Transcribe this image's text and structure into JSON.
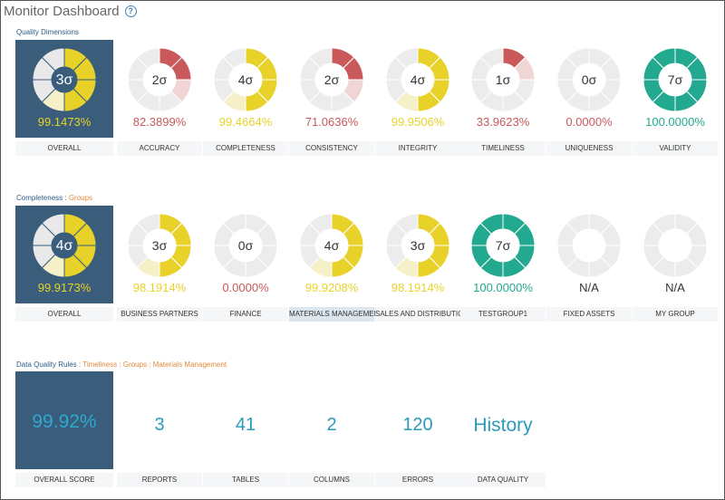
{
  "title": "Monitor Dashboard",
  "help_icon": "?",
  "colors": {
    "red": "#c9595b",
    "yellow": "#e8d22a",
    "green": "#22a98f",
    "blue": "#2a9abb",
    "tile": "#3a5d7c",
    "track": "#ececec"
  },
  "quality": {
    "label": "Quality Dimensions",
    "cards": [
      {
        "caption": "OVERALL",
        "sigma": "3σ",
        "pct": "99.1473%",
        "value": 0.6,
        "color": "yellow",
        "overall": true
      },
      {
        "caption": "ACCURACY",
        "sigma": "2σ",
        "pct": "82.3899%",
        "value": 0.35,
        "color": "red"
      },
      {
        "caption": "COMPLETENESS",
        "sigma": "4σ",
        "pct": "99.4664%",
        "value": 0.6,
        "color": "yellow"
      },
      {
        "caption": "CONSISTENCY",
        "sigma": "2σ",
        "pct": "71.0636%",
        "value": 0.25,
        "color": "red"
      },
      {
        "caption": "INTEGRITY",
        "sigma": "4σ",
        "pct": "99.9506%",
        "value": 0.62,
        "color": "yellow"
      },
      {
        "caption": "TIMELINESS",
        "sigma": "1σ",
        "pct": "33.9623%",
        "value": 0.13,
        "color": "red"
      },
      {
        "caption": "UNIQUENESS",
        "sigma": "0σ",
        "pct": "0.0000%",
        "value": 0,
        "color": "red"
      },
      {
        "caption": "VALIDITY",
        "sigma": "7σ",
        "pct": "100.0000%",
        "value": 1,
        "color": "green"
      }
    ]
  },
  "completeness": {
    "label": "Completeness",
    "sep": " : ",
    "link": "Groups",
    "cards": [
      {
        "caption": "OVERALL",
        "sigma": "4σ",
        "pct": "99.9173%",
        "value": 0.62,
        "color": "yellow",
        "overall": true
      },
      {
        "caption": "BUSINESS PARTNERS",
        "sigma": "3σ",
        "pct": "98.1914%",
        "value": 0.6,
        "color": "yellow"
      },
      {
        "caption": "FINANCE",
        "sigma": "0σ",
        "pct": "0.0000%",
        "value": 0,
        "color": "red"
      },
      {
        "caption": "MATERIALS MANAGEMENT",
        "sigma": "4σ",
        "pct": "99.9208%",
        "value": 0.62,
        "color": "yellow",
        "selected": true
      },
      {
        "caption": "SALES AND DISTRIBUTION",
        "sigma": "3σ",
        "pct": "98.1914%",
        "value": 0.6,
        "color": "yellow"
      },
      {
        "caption": "TESTGROUP1",
        "sigma": "7σ",
        "pct": "100.0000%",
        "value": 1,
        "color": "green"
      },
      {
        "caption": "FIXED ASSETS",
        "sigma": "",
        "pct": "N/A",
        "value": 0,
        "color": "na"
      },
      {
        "caption": "MY GROUP",
        "sigma": "",
        "pct": "N/A",
        "value": 0,
        "color": "na"
      }
    ]
  },
  "rules": {
    "label": "Data Quality Rules",
    "sep": " : ",
    "crumbs": [
      "Timeliness",
      "Groups",
      "Materials Management"
    ],
    "overall_value": "99.92%",
    "overall_caption": "OVERALL SCORE",
    "stats": [
      {
        "value": "3",
        "caption": "REPORTS"
      },
      {
        "value": "41",
        "caption": "TABLES"
      },
      {
        "value": "2",
        "caption": "COLUMNS"
      },
      {
        "value": "120",
        "caption": "ERRORS"
      },
      {
        "value": "History",
        "caption": "DATA QUALITY"
      }
    ]
  }
}
